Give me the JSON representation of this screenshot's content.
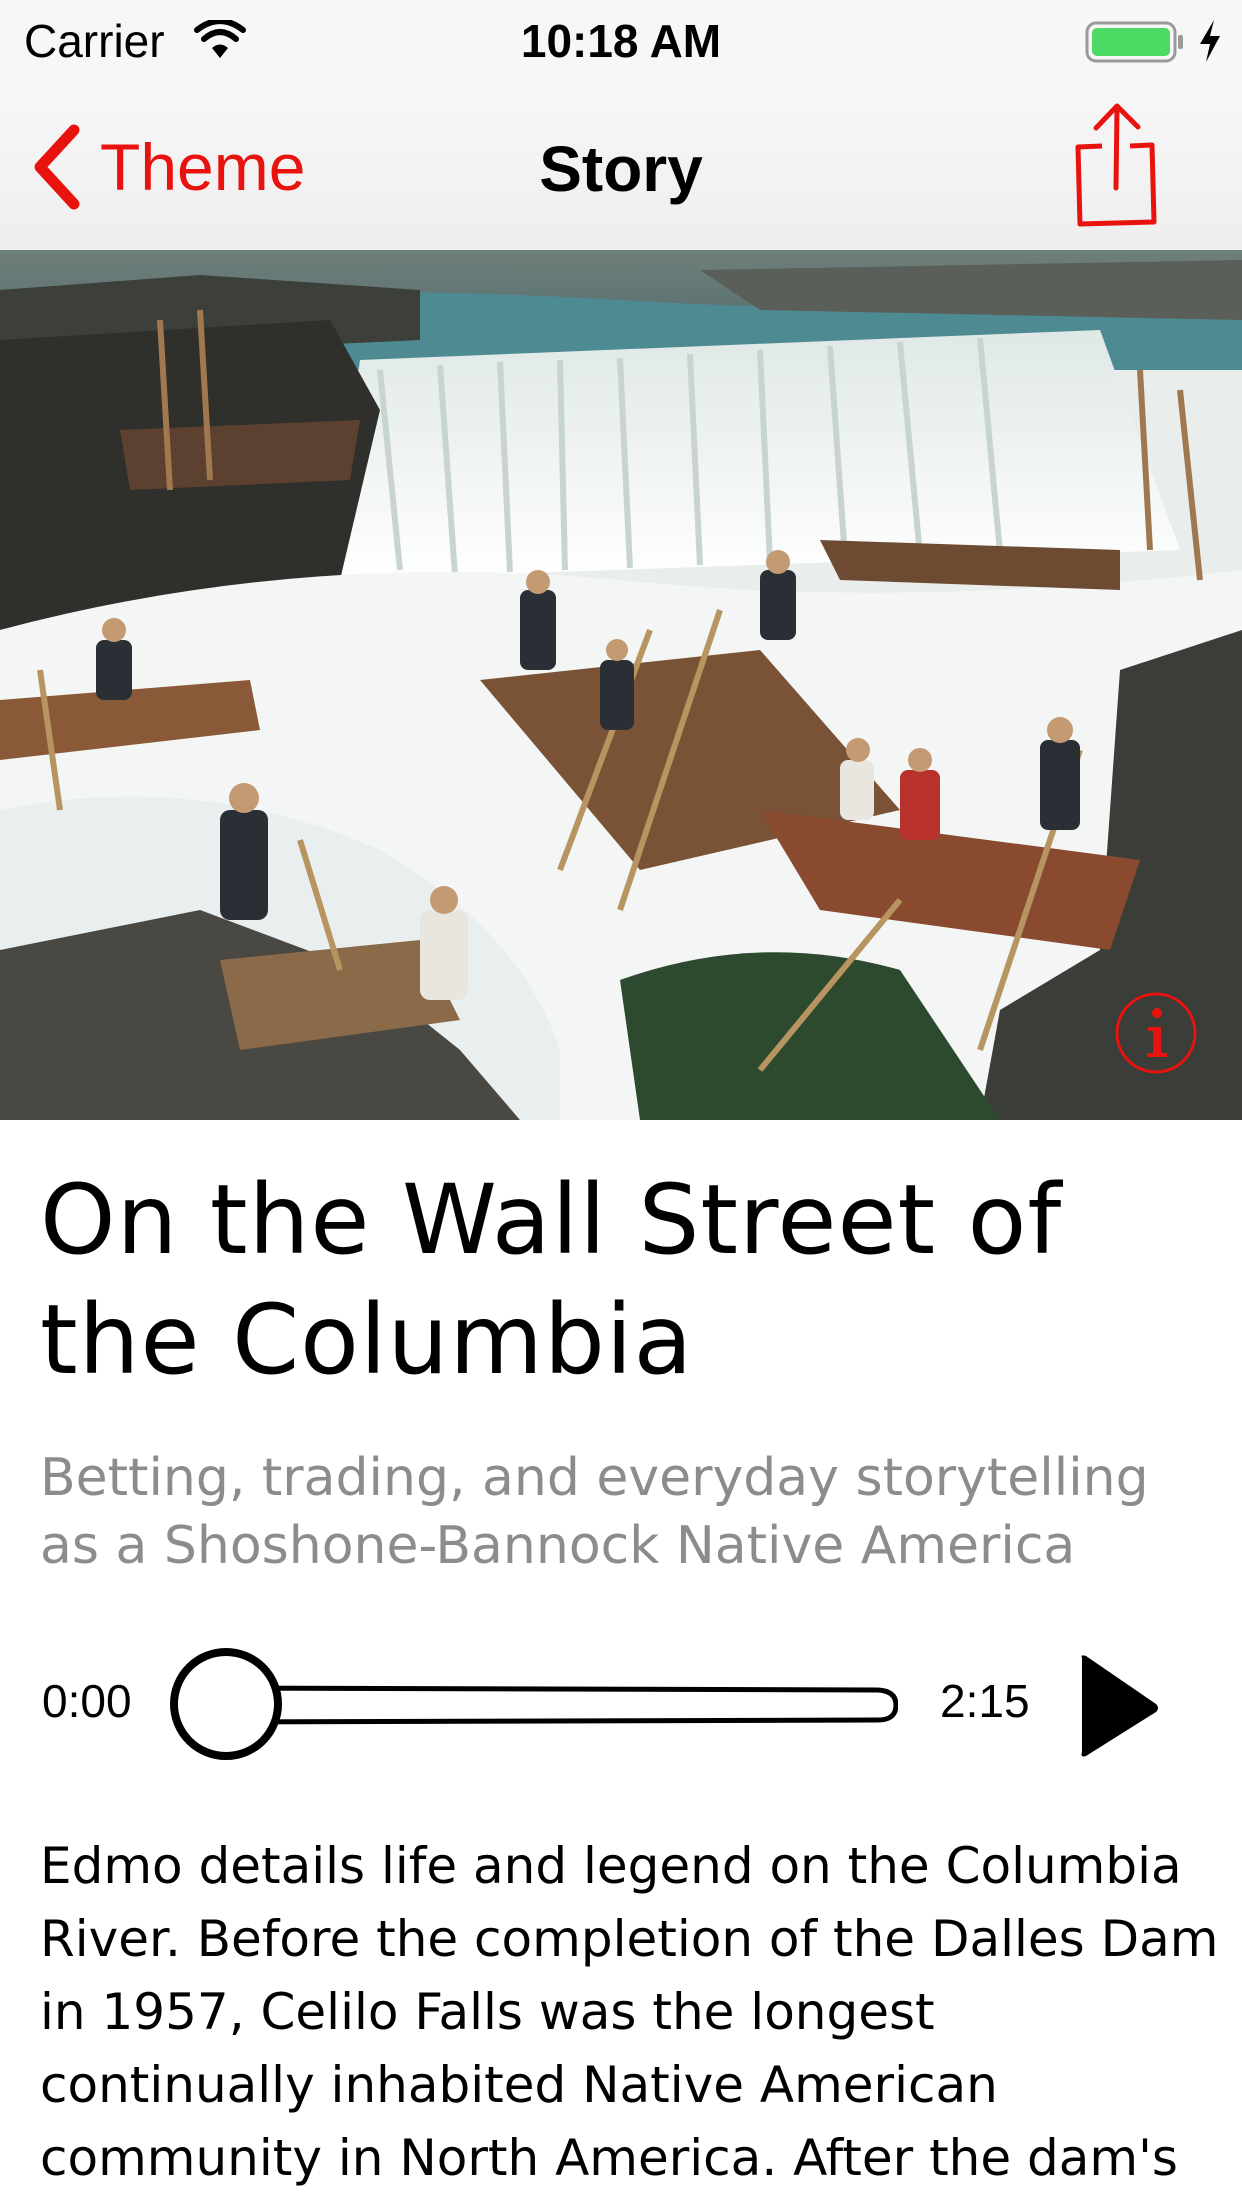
{
  "status_bar": {
    "carrier": "Carrier",
    "time": "10:18 AM",
    "icons": [
      "wifi-icon",
      "battery-icon",
      "charging-icon"
    ],
    "battery_color": "#4cd964"
  },
  "nav": {
    "back_label": "Theme",
    "title": "Story",
    "back_icon": "chevron-left-icon",
    "share_icon": "share-icon",
    "accent_color": "#e8130f"
  },
  "hero": {
    "image": "photo of people fishing from wooden platforms at a waterfall",
    "info_icon": "info-icon"
  },
  "story": {
    "title": "On the Wall Street of the Columbia",
    "subtitle": "Betting, trading, and everyday storytelling as a Shoshone-Bannock Native America",
    "body": "Edmo details life and legend on the Columbia River. Before the completion of the Dalles Dam in 1957, Celilo Falls was the longest continually inhabited Native American community in North America. After the dam's construction,"
  },
  "player": {
    "current_time": "0:00",
    "duration": "2:15",
    "progress": 0,
    "play_icon": "play-icon"
  }
}
